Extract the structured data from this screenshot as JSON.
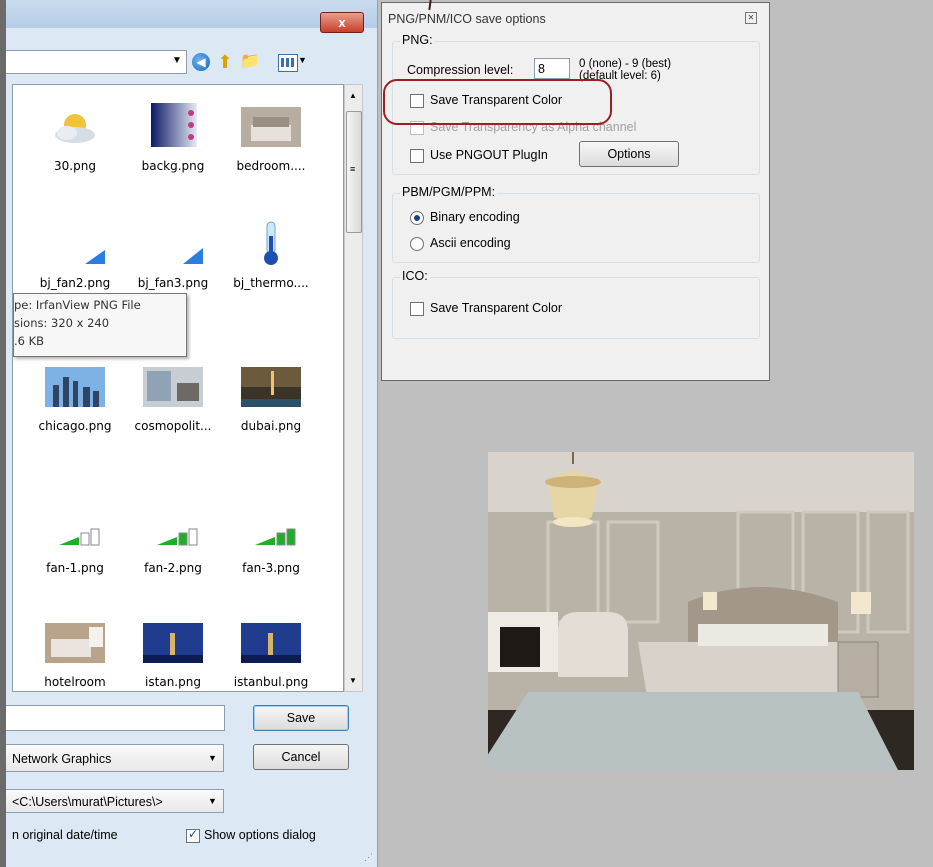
{
  "save_dialog": {
    "close_label": "x",
    "files": [
      {
        "name": "30.png",
        "icon": "sun-cloud-thumbnail"
      },
      {
        "name": "backg.png",
        "icon": "gradient-thumbnail"
      },
      {
        "name": "bedroom....",
        "icon": "bedroom-thumbnail"
      },
      {
        "name": "bj_fan2.png",
        "icon": "fan-thumbnail"
      },
      {
        "name": "bj_fan3.png",
        "icon": "fan-thumbnail"
      },
      {
        "name": "bj_thermo....",
        "icon": "thermometer-thumbnail"
      },
      {
        "name": "chicago.png",
        "icon": "city-thumbnail"
      },
      {
        "name": "cosmopolit...",
        "icon": "interior-thumbnail"
      },
      {
        "name": "dubai.png",
        "icon": "night-city-thumbnail"
      },
      {
        "name": "fan-1.png",
        "icon": "signal-bars-thumbnail"
      },
      {
        "name": "fan-2.png",
        "icon": "signal-bars-thumbnail"
      },
      {
        "name": "fan-3.png",
        "icon": "signal-bars-thumbnail"
      },
      {
        "name": "hotelroom",
        "icon": "hotelroom-thumbnail"
      },
      {
        "name": "istan.png",
        "icon": "istanbul-thumbnail"
      },
      {
        "name": "istanbul.png",
        "icon": "istanbul-thumbnail"
      }
    ],
    "tooltip": {
      "line1": "pe: IrfanView PNG File",
      "line2": "sions: 320 x 240",
      "line3": ".6 KB"
    },
    "filename_value": "",
    "save_label": "Save",
    "cancel_label": "Cancel",
    "filetype_value": "Network Graphics",
    "location_value": "<C:\\Users\\murat\\Pictures\\>",
    "keep_date_label": "n original date/time",
    "show_options_label": "Show options dialog",
    "show_options_checked": true
  },
  "options_dialog": {
    "title": "PNG/PNM/ICO save options",
    "png": {
      "group_label": "PNG:",
      "compression_label": "Compression level:",
      "compression_value": "8",
      "compression_hint1": "0 (none) - 9 (best)",
      "compression_hint2": "(default level: 6)",
      "save_transparent_label": "Save Transparent Color",
      "save_alpha_label": "Save Transparency as Alpha channel",
      "use_pngout_label": "Use PNGOUT PlugIn",
      "options_button": "Options"
    },
    "pnm": {
      "group_label": "PBM/PGM/PPM:",
      "binary_label": "Binary encoding",
      "ascii_label": "Ascii encoding"
    },
    "ico": {
      "group_label": "ICO:",
      "save_transparent_label": "Save Transparent Color"
    }
  },
  "colors": {
    "highlight_ring": "#9b1f24",
    "dialog_bg": "#dce8f4",
    "options_bg": "#f0f0f0"
  }
}
